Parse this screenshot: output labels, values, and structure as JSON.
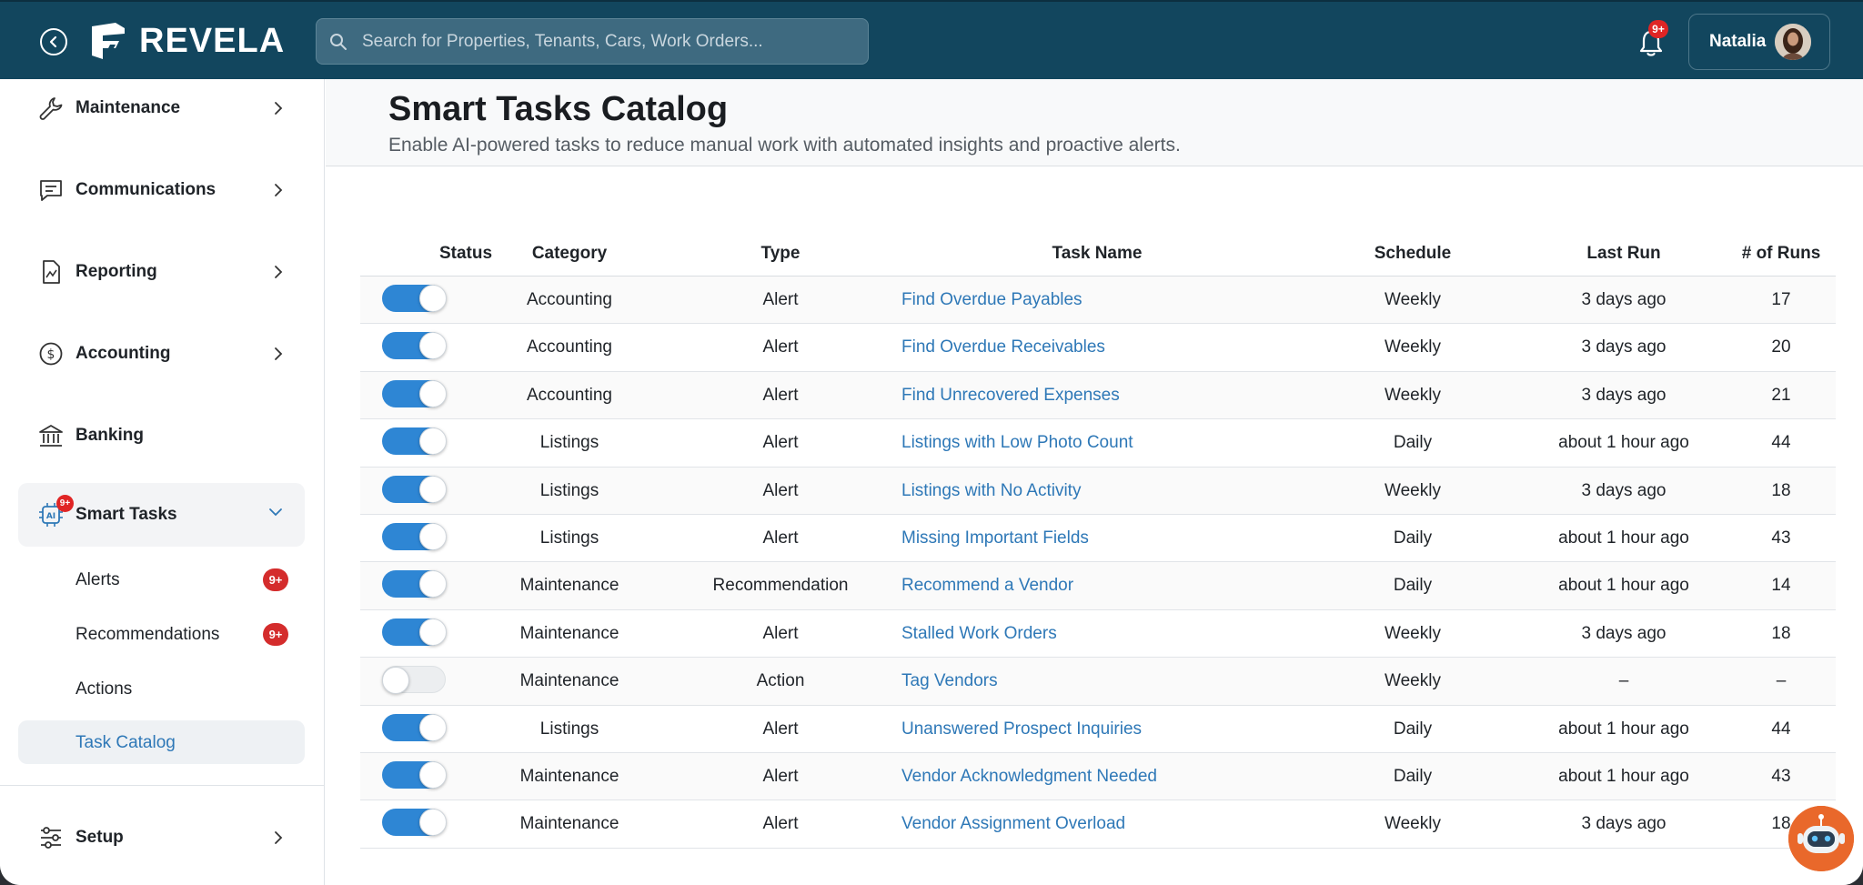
{
  "brand": {
    "name": "REVELA"
  },
  "search": {
    "placeholder": "Search for Properties, Tenants, Cars, Work Orders..."
  },
  "notifications": {
    "badge": "9+"
  },
  "user": {
    "name": "Natalia"
  },
  "sidebar": {
    "items": [
      {
        "label": "Maintenance",
        "icon": "wrench-icon"
      },
      {
        "label": "Communications",
        "icon": "chat-icon"
      },
      {
        "label": "Reporting",
        "icon": "report-icon"
      },
      {
        "label": "Accounting",
        "icon": "dollar-icon"
      },
      {
        "label": "Banking",
        "icon": "bank-icon"
      },
      {
        "label": "Smart Tasks",
        "icon": "ai-chip-icon",
        "badge": "9+"
      }
    ],
    "sub_items": [
      {
        "label": "Alerts",
        "badge": "9+"
      },
      {
        "label": "Recommendations",
        "badge": "9+"
      },
      {
        "label": "Actions"
      },
      {
        "label": "Task Catalog"
      }
    ],
    "setup": {
      "label": "Setup",
      "icon": "sliders-icon"
    }
  },
  "page": {
    "title": "Smart Tasks Catalog",
    "subtitle": "Enable AI-powered tasks to reduce manual work with automated insights and proactive alerts."
  },
  "table": {
    "headers": [
      "Status",
      "Category",
      "Type",
      "Task Name",
      "Schedule",
      "Last Run",
      "# of Runs"
    ],
    "rows": [
      {
        "enabled": true,
        "category": "Accounting",
        "type": "Alert",
        "task": "Find Overdue Payables",
        "schedule": "Weekly",
        "last_run": "3 days ago",
        "runs": "17"
      },
      {
        "enabled": true,
        "category": "Accounting",
        "type": "Alert",
        "task": "Find Overdue Receivables",
        "schedule": "Weekly",
        "last_run": "3 days ago",
        "runs": "20"
      },
      {
        "enabled": true,
        "category": "Accounting",
        "type": "Alert",
        "task": "Find Unrecovered Expenses",
        "schedule": "Weekly",
        "last_run": "3 days ago",
        "runs": "21"
      },
      {
        "enabled": true,
        "category": "Listings",
        "type": "Alert",
        "task": "Listings with Low Photo Count",
        "schedule": "Daily",
        "last_run": "about 1 hour ago",
        "runs": "44"
      },
      {
        "enabled": true,
        "category": "Listings",
        "type": "Alert",
        "task": "Listings with No Activity",
        "schedule": "Weekly",
        "last_run": "3 days ago",
        "runs": "18"
      },
      {
        "enabled": true,
        "category": "Listings",
        "type": "Alert",
        "task": "Missing Important Fields",
        "schedule": "Daily",
        "last_run": "about 1 hour ago",
        "runs": "43"
      },
      {
        "enabled": true,
        "category": "Maintenance",
        "type": "Recommendation",
        "task": "Recommend a Vendor",
        "schedule": "Daily",
        "last_run": "about 1 hour ago",
        "runs": "14"
      },
      {
        "enabled": true,
        "category": "Maintenance",
        "type": "Alert",
        "task": "Stalled Work Orders",
        "schedule": "Weekly",
        "last_run": "3 days ago",
        "runs": "18"
      },
      {
        "enabled": false,
        "category": "Maintenance",
        "type": "Action",
        "task": "Tag Vendors",
        "schedule": "Weekly",
        "last_run": "–",
        "runs": "–"
      },
      {
        "enabled": true,
        "category": "Listings",
        "type": "Alert",
        "task": "Unanswered Prospect Inquiries",
        "schedule": "Daily",
        "last_run": "about 1 hour ago",
        "runs": "44"
      },
      {
        "enabled": true,
        "category": "Maintenance",
        "type": "Alert",
        "task": "Vendor Acknowledgment Needed",
        "schedule": "Daily",
        "last_run": "about 1 hour ago",
        "runs": "43"
      },
      {
        "enabled": true,
        "category": "Maintenance",
        "type": "Alert",
        "task": "Vendor Assignment Overload",
        "schedule": "Weekly",
        "last_run": "3 days ago",
        "runs": "18"
      }
    ]
  },
  "colors": {
    "topbar": "#12465e",
    "accent": "#2e86d4",
    "link": "#2e78b7",
    "badge": "#e02525"
  }
}
